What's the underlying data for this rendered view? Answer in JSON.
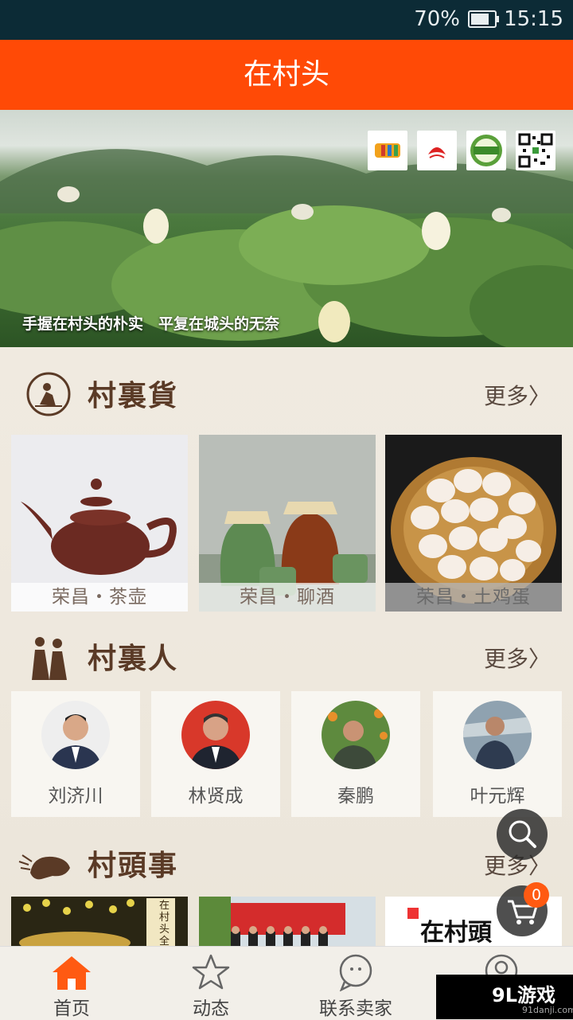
{
  "status": {
    "battery": "70%",
    "time": "15:15"
  },
  "header": {
    "title": "在村头"
  },
  "banner": {
    "slogan": "手握在村头的朴实　平复在城头的无奈",
    "logos": [
      "eleven-icon",
      "fish-logo",
      "在村头",
      "qr-code"
    ]
  },
  "sections": {
    "goods": {
      "title": "村裏貨",
      "more": "更多"
    },
    "people": {
      "title": "村裏人",
      "more": "更多"
    },
    "stories": {
      "title": "村頭事",
      "more": "更多"
    }
  },
  "products": [
    {
      "label": "荣昌・茶壶"
    },
    {
      "label": "荣昌・聊酒"
    },
    {
      "label": "荣昌・土鸡蛋"
    }
  ],
  "persons": [
    {
      "name": "刘济川"
    },
    {
      "name": "林贤成"
    },
    {
      "name": "秦鹏"
    },
    {
      "name": "叶元辉"
    }
  ],
  "stories": [
    {
      "label": "在村头全"
    },
    {
      "label": ""
    },
    {
      "label": "在村頭"
    }
  ],
  "cart": {
    "count": "0"
  },
  "tabs": [
    {
      "label": "首页",
      "icon": "home-icon"
    },
    {
      "label": "动态",
      "icon": "star-icon"
    },
    {
      "label": "联系卖家",
      "icon": "chat-icon"
    },
    {
      "label": "",
      "icon": "user-icon"
    }
  ],
  "watermark": {
    "main": "9L游戏",
    "sub": "91danji.com"
  },
  "colors": {
    "accent": "#ff4a06",
    "statusbar": "#0c2b36",
    "title": "#5a3a26"
  }
}
